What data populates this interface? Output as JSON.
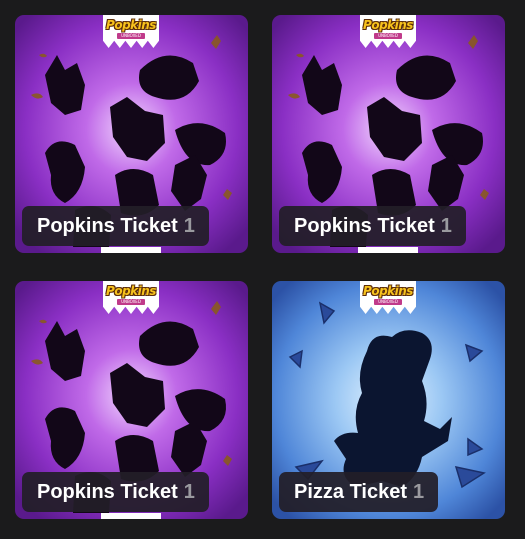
{
  "tickets": [
    {
      "title": "Popkins Ticket",
      "count": "1",
      "theme": "popkins",
      "icon": "popkins-silhouettes-image"
    },
    {
      "title": "Popkins Ticket",
      "count": "1",
      "theme": "popkins",
      "icon": "popkins-silhouettes-image"
    },
    {
      "title": "Popkins Ticket",
      "count": "1",
      "theme": "popkins",
      "icon": "popkins-silhouettes-image"
    },
    {
      "title": "Pizza Ticket",
      "count": "1",
      "theme": "pizza",
      "icon": "pizza-creature-silhouette-image"
    }
  ],
  "brand": {
    "logo_text": "Popkins",
    "logo_subtext": "UNBOXED"
  },
  "colors": {
    "background": "#1b1b1c",
    "popkins_bg": "#8a2fc4",
    "pizza_bg": "#4f86d8",
    "label_bg": "#221e28",
    "label_text": "#ffffff",
    "count_text": "#9a9a9f",
    "logo_yellow": "#f7c21c"
  }
}
